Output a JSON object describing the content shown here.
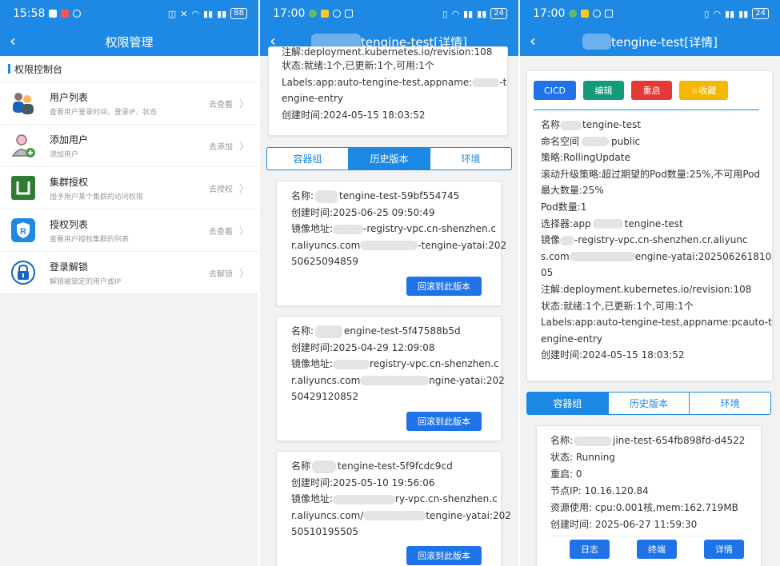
{
  "panel1": {
    "status": {
      "time": "15:58",
      "battery": "88"
    },
    "nav_title": "权限管理",
    "section_title": "权限控制台",
    "menu": [
      {
        "title": "用户列表",
        "subtitle": "查看用户登录时间、登录IP、状态",
        "action": "去查看",
        "icon": "users-icon"
      },
      {
        "title": "添加用户",
        "subtitle": "添加用户",
        "action": "去添加",
        "icon": "add-user-icon"
      },
      {
        "title": "集群授权",
        "subtitle": "授予用户某个集群的访问权限",
        "action": "去授权",
        "icon": "cluster-auth-icon"
      },
      {
        "title": "授权列表",
        "subtitle": "查看用户授权集群的列表",
        "action": "去查看",
        "icon": "shield-r-icon"
      },
      {
        "title": "登录解锁",
        "subtitle": "解锁被锁定的用户或IP",
        "action": "去解锁",
        "icon": "lock-icon"
      }
    ]
  },
  "panel2": {
    "status": {
      "time": "17:00",
      "battery": "24"
    },
    "nav_title": "tengine-test[详情]",
    "info_lines": [
      "注解:deployment.kubernetes.io/revision:108",
      "状态:就绪:1个,已更新:1个,可用:1个",
      "Labels:app:auto-tengine-test,appname:",
      "-t",
      "engine-entry",
      "创建时间:2024-05-15 18:03:52"
    ],
    "tabs": [
      "容器组",
      "历史版本",
      "环境"
    ],
    "active_tab": 1,
    "history": [
      {
        "name_label": "名称:",
        "name": "tengine-test-59bf554745",
        "created": "创建时间:2025-06-25 09:50:49",
        "image_l1a": "镜像地址:",
        "image_l1b": "-registry-vpc.cn-shenzhen.c",
        "image_l2a": "r.aliyuncs.com",
        "image_l2b": "-tengine-yatai:202",
        "image_l3": "50625094859",
        "button": "回滚到此版本"
      },
      {
        "name_label": "名称:",
        "name": "engine-test-5f47588b5d",
        "created": "创建时间:2025-04-29 12:09:08",
        "image_l1a": "镜像地址:",
        "image_l1b": "registry-vpc.cn-shenzhen.c",
        "image_l2a": "r.aliyuncs.com",
        "image_l2b": "ngine-yatai:202",
        "image_l3": "50429120852",
        "button": "回滚到此版本"
      },
      {
        "name_label": "名称",
        "name": "tengine-test-5f9fcdc9cd",
        "created": "创建时间:2025-05-10 19:56:06",
        "image_l1a": "镜像地址:",
        "image_l1b": "ry-vpc.cn-shenzhen.c",
        "image_l2a": "r.aliyuncs.com/",
        "image_l2b": "tengine-yatai:202",
        "image_l3": "50510195505",
        "button": "回滚到此版本"
      }
    ]
  },
  "panel3": {
    "status": {
      "time": "17:00",
      "battery": "24"
    },
    "nav_title": "tengine-test[详情]",
    "actions": [
      {
        "label": "CICD",
        "color": "#1e73e8"
      },
      {
        "label": "编辑",
        "color": "#129c7a"
      },
      {
        "label": "重启",
        "color": "#e53935"
      },
      {
        "label": "☆收藏",
        "color": "#f5b800"
      }
    ],
    "detail": {
      "name_a": "名称",
      "name_b": "tengine-test",
      "ns_a": "命名空间",
      "ns_b": "public",
      "strategy": "策略:RollingUpdate",
      "rolling_1": "滚动升级策略:超过期望的Pod数量:25%,不可用Pod",
      "rolling_2": "最大数量:25%",
      "pods": "Pod数量:1",
      "selector_a": "选择器:app",
      "selector_b": "tengine-test",
      "image_1a": "镜像",
      "image_1b": "-registry-vpc.cn-shenzhen.cr.aliyunc",
      "image_2a": "s.com",
      "image_2b": "engine-yatai:202506261810",
      "image_3": "05",
      "annotation": "注解:deployment.kubernetes.io/revision:108",
      "status": "状态:就绪:1个,已更新:1个,可用:1个",
      "labels_1": "Labels:app:auto-tengine-test,appname:pcauto-t",
      "labels_2": "engine-entry",
      "created": "创建时间:2024-05-15 18:03:52"
    },
    "tabs": [
      "容器组",
      "历史版本",
      "环境"
    ],
    "active_tab": 0,
    "pod": {
      "name_a": "名称:",
      "name_b": "jine-test-654fb898fd-d4522",
      "state": "状态: Running",
      "restart": "重启: 0",
      "node_ip": "节点IP: 10.16.120.84",
      "resources": "资源使用: cpu:0.001核,mem:162.719MB",
      "created": "创建时间: 2025-06-27 11:59:30",
      "buttons": [
        "日志",
        "终端",
        "详情"
      ]
    }
  }
}
